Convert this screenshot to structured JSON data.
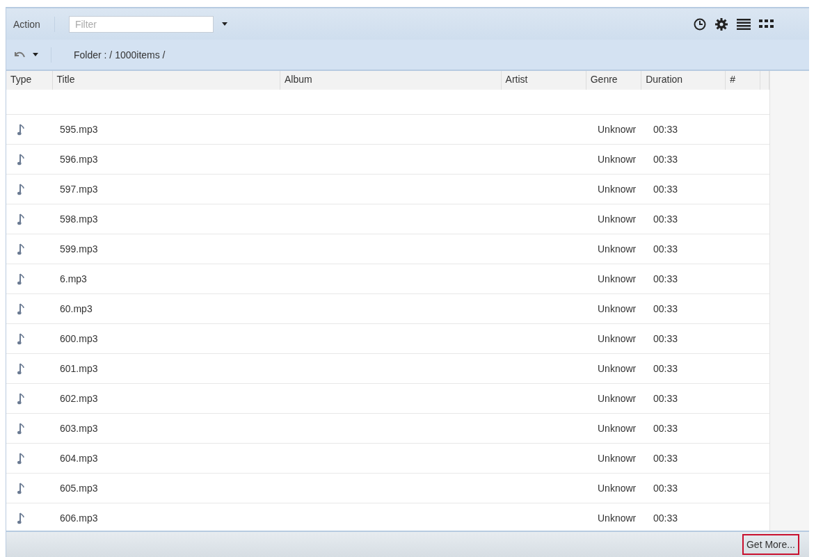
{
  "toolbar": {
    "action": "Action",
    "filter": {
      "placeholder": "Filter"
    }
  },
  "path_bar": {
    "folder": "Folder : / 1000items /"
  },
  "table": {
    "columns": [
      "Type",
      "Title",
      "Album",
      "Artist",
      "Genre",
      "Duration",
      "#"
    ],
    "rows": [
      {
        "title": "595.mp3",
        "genre": "Unknowr",
        "duration": "00:33"
      },
      {
        "title": "596.mp3",
        "genre": "Unknowr",
        "duration": "00:33"
      },
      {
        "title": "597.mp3",
        "genre": "Unknowr",
        "duration": "00:33"
      },
      {
        "title": "598.mp3",
        "genre": "Unknowr",
        "duration": "00:33"
      },
      {
        "title": "599.mp3",
        "genre": "Unknowr",
        "duration": "00:33"
      },
      {
        "title": "6.mp3",
        "genre": "Unknowr",
        "duration": "00:33"
      },
      {
        "title": "60.mp3",
        "genre": "Unknowr",
        "duration": "00:33"
      },
      {
        "title": "600.mp3",
        "genre": "Unknowr",
        "duration": "00:33"
      },
      {
        "title": "601.mp3",
        "genre": "Unknowr",
        "duration": "00:33"
      },
      {
        "title": "602.mp3",
        "genre": "Unknowr",
        "duration": "00:33"
      },
      {
        "title": "603.mp3",
        "genre": "Unknowr",
        "duration": "00:33"
      },
      {
        "title": "604.mp3",
        "genre": "Unknowr",
        "duration": "00:33"
      },
      {
        "title": "605.mp3",
        "genre": "Unknowr",
        "duration": "00:33"
      },
      {
        "title": "606.mp3",
        "genre": "Unknowr",
        "duration": "00:33"
      }
    ]
  },
  "footer": {
    "button": "Get More..."
  }
}
